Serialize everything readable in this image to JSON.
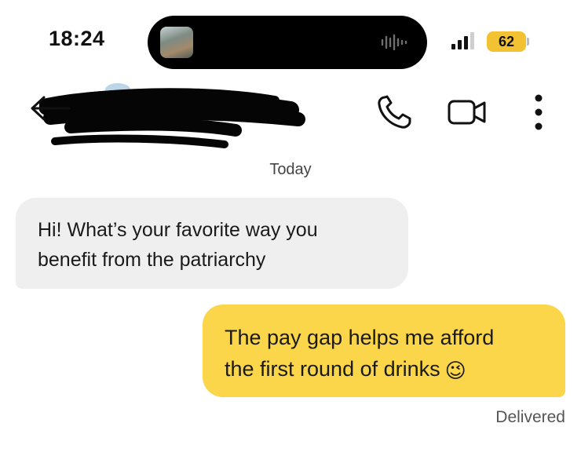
{
  "status_bar": {
    "time": "18:24",
    "battery_percent": "62",
    "icons": [
      "waveform-icon",
      "signal-icon",
      "battery-icon"
    ]
  },
  "header": {
    "contact_name": "",
    "icons": [
      "back-arrow-icon",
      "phone-icon",
      "video-camera-icon",
      "more-vertical-icon"
    ]
  },
  "conversation": {
    "date_divider": "Today",
    "messages": [
      {
        "direction": "incoming",
        "lines": [
          "Hi! What’s your favorite way you",
          "benefit from the patriarchy"
        ]
      },
      {
        "direction": "outgoing",
        "lines": [
          "The pay gap helps me afford",
          "the first round of drinks"
        ],
        "emoji": "😉"
      }
    ],
    "receipt": "Delivered"
  },
  "colors": {
    "outgoing_bubble": "#fbd54a",
    "incoming_bubble": "#efefef",
    "battery": "#f2c233"
  }
}
